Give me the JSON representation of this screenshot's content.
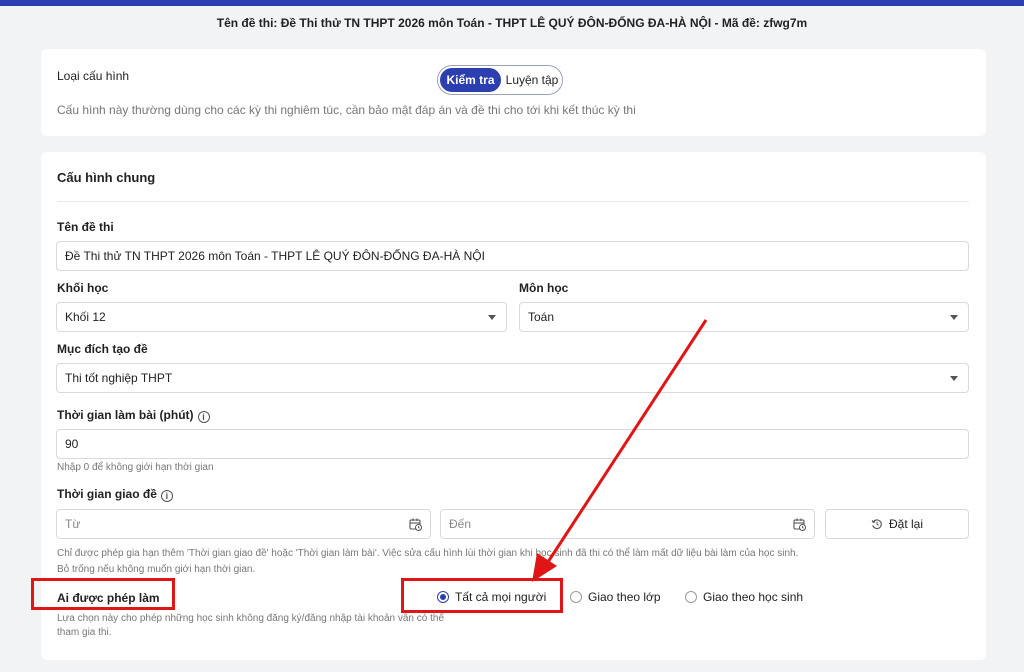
{
  "header": {
    "exam_title": "Tên đề thi: Đề Thi thử TN THPT 2026 môn Toán - THPT LÊ QUÝ ĐÔN-ĐỐNG ĐA-HÀ NỘI - Mã đề: zfwg7m"
  },
  "config_type": {
    "label": "Loại cấu hình",
    "options": [
      "Kiểm tra",
      "Luyện tập"
    ],
    "selected": "Kiểm tra",
    "description": "Cấu hình này thường dùng cho các kỳ thi nghiêm túc, cần bảo mật đáp án và đề thi cho tới khi kết thúc kỳ thi"
  },
  "general": {
    "section_title": "Cấu hình chung",
    "exam_name": {
      "label": "Tên đề thi",
      "value": "Đề Thi thử TN THPT 2026 môn Toán - THPT LÊ QUÝ ĐÔN-ĐỐNG ĐA-HÀ NỘI"
    },
    "grade": {
      "label": "Khối học",
      "value": "Khối 12"
    },
    "subject": {
      "label": "Môn học",
      "value": "Toán"
    },
    "purpose": {
      "label": "Mục đích tạo đề",
      "value": "Thi tốt nghiệp THPT"
    },
    "duration": {
      "label": "Thời gian làm bài (phút)",
      "value": "90",
      "hint": "Nhập 0 để không giới hạn thời gian"
    },
    "assign_time": {
      "label": "Thời gian giao đề",
      "from_placeholder": "Từ",
      "to_placeholder": "Đến",
      "reset_label": "Đặt lại",
      "hint_line1": "Chỉ được phép gia hạn thêm 'Thời gian giao đề' hoặc 'Thời gian làm bài'. Việc sửa cấu hình lùi thời gian khi học sinh đã thi có thể làm mất dữ liệu bài làm của học sinh.",
      "hint_line2": "Bỏ trống nếu không muốn giới hạn thời gian."
    },
    "who_can_take": {
      "label": "Ai được phép làm",
      "options": [
        "Tất cả mọi người",
        "Giao theo lớp",
        "Giao theo học sinh"
      ],
      "selected": "Tất cả mọi người",
      "hint_line1": "Lựa chọn này cho phép những học sinh không đăng ký/đăng nhập tài khoản vẫn có thể",
      "hint_line2": "tham gia thi."
    }
  },
  "colors": {
    "accent": "#2b3fb0",
    "annotation": "#e01616"
  }
}
